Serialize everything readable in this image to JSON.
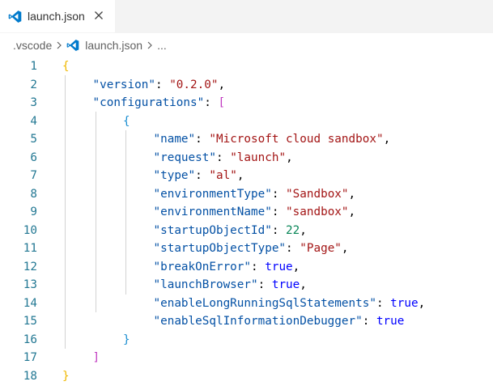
{
  "tab": {
    "title": "launch.json",
    "close_icon": "close-icon"
  },
  "breadcrumb": {
    "folder": ".vscode",
    "file": "launch.json",
    "ellipsis": "..."
  },
  "colors": {
    "line_number": "#237893",
    "key": "#0451a5",
    "string": "#a31515",
    "number": "#098658",
    "keyword": "#0000ff",
    "bracket_level1": "#f0b800",
    "bracket_level2": "#c039c0",
    "bracket_level3": "#1d8fd1",
    "vscode_icon": "#007acc"
  },
  "editor": {
    "lines": [
      {
        "n": "1",
        "tokens": [
          [
            "b1",
            "{"
          ]
        ]
      },
      {
        "n": "2",
        "tokens": [
          [
            "key",
            "\"version\""
          ],
          [
            "p",
            ": "
          ],
          [
            "str",
            "\"0.2.0\""
          ],
          [
            "p",
            ","
          ]
        ]
      },
      {
        "n": "3",
        "tokens": [
          [
            "key",
            "\"configurations\""
          ],
          [
            "p",
            ": "
          ],
          [
            "b2",
            "["
          ]
        ]
      },
      {
        "n": "4",
        "tokens": [
          [
            "b3",
            "{"
          ]
        ]
      },
      {
        "n": "5",
        "tokens": [
          [
            "key",
            "\"name\""
          ],
          [
            "p",
            ": "
          ],
          [
            "str",
            "\"Microsoft cloud sandbox\""
          ],
          [
            "p",
            ","
          ]
        ]
      },
      {
        "n": "6",
        "tokens": [
          [
            "key",
            "\"request\""
          ],
          [
            "p",
            ": "
          ],
          [
            "str",
            "\"launch\""
          ],
          [
            "p",
            ","
          ]
        ]
      },
      {
        "n": "7",
        "tokens": [
          [
            "key",
            "\"type\""
          ],
          [
            "p",
            ": "
          ],
          [
            "str",
            "\"al\""
          ],
          [
            "p",
            ","
          ]
        ]
      },
      {
        "n": "8",
        "tokens": [
          [
            "key",
            "\"environmentType\""
          ],
          [
            "p",
            ": "
          ],
          [
            "str",
            "\"Sandbox\""
          ],
          [
            "p",
            ","
          ]
        ]
      },
      {
        "n": "9",
        "tokens": [
          [
            "key",
            "\"environmentName\""
          ],
          [
            "p",
            ": "
          ],
          [
            "str",
            "\"sandbox\""
          ],
          [
            "p",
            ","
          ]
        ]
      },
      {
        "n": "10",
        "tokens": [
          [
            "key",
            "\"startupObjectId\""
          ],
          [
            "p",
            ": "
          ],
          [
            "num",
            "22"
          ],
          [
            "p",
            ","
          ]
        ]
      },
      {
        "n": "11",
        "tokens": [
          [
            "key",
            "\"startupObjectType\""
          ],
          [
            "p",
            ": "
          ],
          [
            "str",
            "\"Page\""
          ],
          [
            "p",
            ","
          ]
        ]
      },
      {
        "n": "12",
        "tokens": [
          [
            "key",
            "\"breakOnError\""
          ],
          [
            "p",
            ": "
          ],
          [
            "kw",
            "true"
          ],
          [
            "p",
            ","
          ]
        ]
      },
      {
        "n": "13",
        "tokens": [
          [
            "key",
            "\"launchBrowser\""
          ],
          [
            "p",
            ": "
          ],
          [
            "kw",
            "true"
          ],
          [
            "p",
            ","
          ]
        ]
      },
      {
        "n": "14",
        "tokens": [
          [
            "key",
            "\"enableLongRunningSqlStatements\""
          ],
          [
            "p",
            ": "
          ],
          [
            "kw",
            "true"
          ],
          [
            "p",
            ","
          ]
        ]
      },
      {
        "n": "15",
        "tokens": [
          [
            "key",
            "\"enableSqlInformationDebugger\""
          ],
          [
            "p",
            ": "
          ],
          [
            "kw",
            "true"
          ]
        ]
      },
      {
        "n": "16",
        "tokens": [
          [
            "b3",
            "}"
          ]
        ]
      },
      {
        "n": "17",
        "tokens": [
          [
            "b2",
            "]"
          ]
        ]
      },
      {
        "n": "18",
        "tokens": [
          [
            "b1",
            "}"
          ]
        ]
      }
    ]
  }
}
